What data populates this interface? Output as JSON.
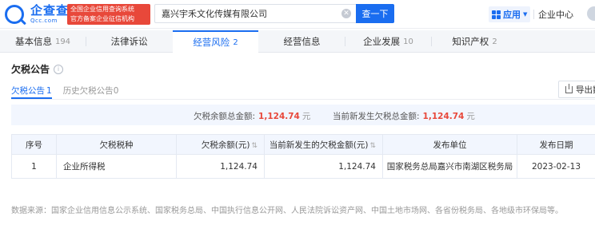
{
  "header": {
    "logo_cn": "企查查",
    "logo_en": "Qcc.com",
    "badge_line1": "全国企业信用查询系统",
    "badge_line2": "官方备案企业征信机构",
    "search_value": "嘉兴宇禾文化传媒有限公司",
    "search_button": "查一下",
    "apps_label": "应用",
    "enterprise_center": "企业中心"
  },
  "tabs": [
    {
      "label": "基本信息",
      "count": "194",
      "active": false
    },
    {
      "label": "法律诉讼",
      "count": "",
      "active": false
    },
    {
      "label": "经营风险",
      "count": "2",
      "active": true
    },
    {
      "label": "经营信息",
      "count": "",
      "active": false
    },
    {
      "label": "企业发展",
      "count": "10",
      "active": false
    },
    {
      "label": "知识产权",
      "count": "2",
      "active": false
    }
  ],
  "section": {
    "title": "欠税公告",
    "subtabs": [
      {
        "label": "欠税公告",
        "count": "1",
        "active": true
      },
      {
        "label": "历史欠税公告",
        "count": "0",
        "active": false
      }
    ],
    "export_label": "导出数"
  },
  "summary": {
    "balance_label": "欠税余额总金额:",
    "balance_value": "1,124.74",
    "balance_unit": "元",
    "new_label": "当前新发生欠税总金额:",
    "new_value": "1,124.74",
    "new_unit": "元"
  },
  "table": {
    "headers": [
      "序号",
      "欠税税种",
      "欠税余额(元)",
      "当前新发生的欠税金额(元)",
      "发布单位",
      "发布日期"
    ],
    "rows": [
      [
        "1",
        "企业所得税",
        "1,124.74",
        "1,124.74",
        "国家税务总局嘉兴市南湖区税务局",
        "2023-02-13"
      ]
    ]
  },
  "source_note": "数据来源：国家企业信用信息公示系统、国家税务总局、中国执行信息公开网、人民法院诉讼资产网、中国土地市场网、各省份税务局、各地级市环保局等。"
}
